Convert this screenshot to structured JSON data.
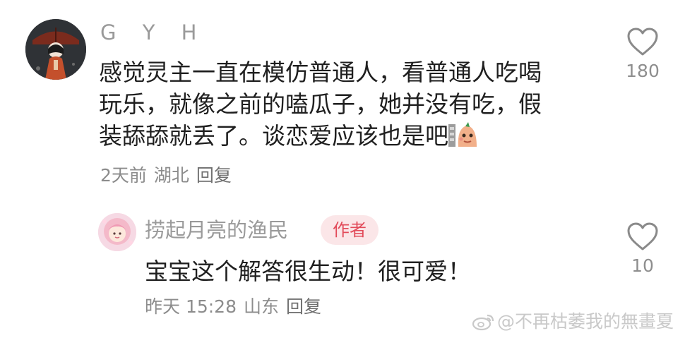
{
  "comment": {
    "username": "G Y H",
    "text_lines": [
      "感觉灵主一直在模仿普通人，看普通人吃喝",
      "玩乐，就像之前的嗑瓜子，她并没有吃，假",
      "装舔舔就丢了。谈恋爱应该也是吧"
    ],
    "emoji": "sweating-sausage-emoji",
    "time": "2天前",
    "location": "湖北",
    "reply_label": "回复",
    "like_count": "180"
  },
  "reply": {
    "username": "捞起月亮的渔民",
    "badge": "作者",
    "text": "宝宝这个解答很生动！很可爱！",
    "time": "昨天 15:28",
    "location": "山东",
    "reply_label": "回复",
    "like_count": "10"
  },
  "watermark": {
    "text": "@不再枯萎我的無畫夏",
    "icon": "weibo-icon"
  },
  "colors": {
    "badge_text": "#e24b5a",
    "badge_bg": "#fbe6e8",
    "meta_gray": "#8c8c8c"
  }
}
